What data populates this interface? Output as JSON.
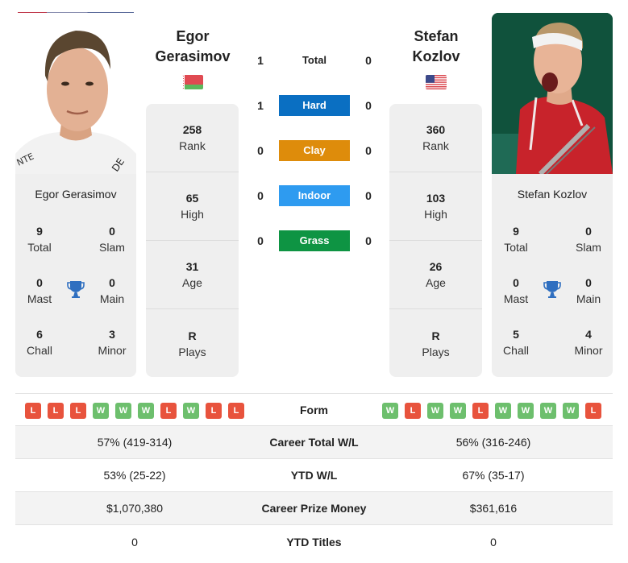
{
  "player1": {
    "name_line1": "Egor",
    "name_line2": "Gerasimov",
    "full_name": "Egor Gerasimov",
    "flag": "belarus-flag",
    "photo": "player-photo",
    "stats": [
      {
        "value": "258",
        "label": "Rank"
      },
      {
        "value": "65",
        "label": "High"
      },
      {
        "value": "31",
        "label": "Age"
      },
      {
        "value": "R",
        "label": "Plays"
      }
    ],
    "titles": {
      "total": {
        "value": "9",
        "label": "Total"
      },
      "slam": {
        "value": "0",
        "label": "Slam"
      },
      "mast": {
        "value": "0",
        "label": "Mast"
      },
      "main": {
        "value": "0",
        "label": "Main"
      },
      "chall": {
        "value": "6",
        "label": "Chall"
      },
      "minor": {
        "value": "3",
        "label": "Minor"
      }
    },
    "form": [
      "L",
      "L",
      "L",
      "W",
      "W",
      "W",
      "L",
      "W",
      "L",
      "L"
    ]
  },
  "player2": {
    "name_line1": "Stefan",
    "name_line2": "Kozlov",
    "full_name": "Stefan Kozlov",
    "flag": "usa-flag",
    "photo": "player-photo",
    "stats": [
      {
        "value": "360",
        "label": "Rank"
      },
      {
        "value": "103",
        "label": "High"
      },
      {
        "value": "26",
        "label": "Age"
      },
      {
        "value": "R",
        "label": "Plays"
      }
    ],
    "titles": {
      "total": {
        "value": "9",
        "label": "Total"
      },
      "slam": {
        "value": "0",
        "label": "Slam"
      },
      "mast": {
        "value": "0",
        "label": "Mast"
      },
      "main": {
        "value": "0",
        "label": "Main"
      },
      "chall": {
        "value": "5",
        "label": "Chall"
      },
      "minor": {
        "value": "4",
        "label": "Minor"
      }
    },
    "form": [
      "W",
      "L",
      "W",
      "W",
      "L",
      "W",
      "W",
      "W",
      "W",
      "L"
    ]
  },
  "h2h": [
    {
      "label": "Total",
      "p1": "1",
      "p2": "0",
      "color": ""
    },
    {
      "label": "Hard",
      "p1": "1",
      "p2": "0",
      "color": "#0a6fc2"
    },
    {
      "label": "Clay",
      "p1": "0",
      "p2": "0",
      "color": "#de8c0b"
    },
    {
      "label": "Indoor",
      "p1": "0",
      "p2": "0",
      "color": "#2e9bf0"
    },
    {
      "label": "Grass",
      "p1": "0",
      "p2": "0",
      "color": "#0e9443"
    }
  ],
  "form_label": "Form",
  "comparison": [
    {
      "label": "Career Total W/L",
      "p1": "57% (419-314)",
      "p2": "56% (316-246)"
    },
    {
      "label": "YTD W/L",
      "p1": "53% (25-22)",
      "p2": "67% (35-17)"
    },
    {
      "label": "Career Prize Money",
      "p1": "$1,070,380",
      "p2": "$361,616"
    },
    {
      "label": "YTD Titles",
      "p1": "0",
      "p2": "0"
    }
  ],
  "colors": {
    "win": "#6dbf6d",
    "loss": "#e8533d",
    "trophy": "#2f6fc0",
    "panel": "#efefef"
  }
}
